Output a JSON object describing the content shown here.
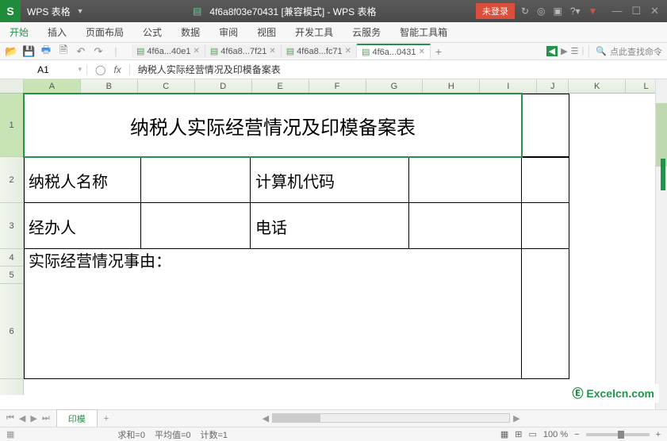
{
  "title": {
    "app": "WPS 表格",
    "doc": "4f6a8f03e70431 [兼容模式] - WPS 表格",
    "login": "未登录"
  },
  "menu": {
    "items": [
      "开始",
      "插入",
      "页面布局",
      "公式",
      "数据",
      "审阅",
      "视图",
      "开发工具",
      "云服务",
      "智能工具箱"
    ],
    "active_index": 0
  },
  "doc_tabs": {
    "items": [
      {
        "label": "4f6a...40e1",
        "active": false
      },
      {
        "label": "4f6a8...7f21",
        "active": false
      },
      {
        "label": "4f6a8...fc71",
        "active": false
      },
      {
        "label": "4f6a...0431",
        "active": true
      }
    ],
    "search_hint": "点此查找命令"
  },
  "formula": {
    "cell_ref": "A1",
    "fx_label": "fx",
    "content": "纳税人实际经营情况及印模备案表"
  },
  "columns": [
    "A",
    "B",
    "C",
    "D",
    "E",
    "F",
    "G",
    "H",
    "I",
    "J",
    "K",
    "L"
  ],
  "rows": [
    "1",
    "2",
    "3",
    "4",
    "5",
    "6"
  ],
  "sheet": {
    "title": "纳税人实际经营情况及印模备案表",
    "r2c1": "纳税人名称",
    "r2c3": "计算机代码",
    "r3c1": "经办人",
    "r3c3": "电话",
    "r4c1": "实际经营情况事由："
  },
  "sheet_tabs": {
    "active": "印模"
  },
  "status": {
    "sum": "求和=0",
    "avg": "平均值=0",
    "count": "计数=1",
    "zoom": "100 %"
  },
  "watermark": "Excelcn.com",
  "chart_data": {
    "type": "table",
    "title": "纳税人实际经营情况及印模备案表",
    "rows": [
      [
        "纳税人名称",
        "",
        "计算机代码",
        ""
      ],
      [
        "经办人",
        "",
        "电话",
        ""
      ],
      [
        "实际经营情况事由：",
        "",
        "",
        ""
      ]
    ]
  }
}
